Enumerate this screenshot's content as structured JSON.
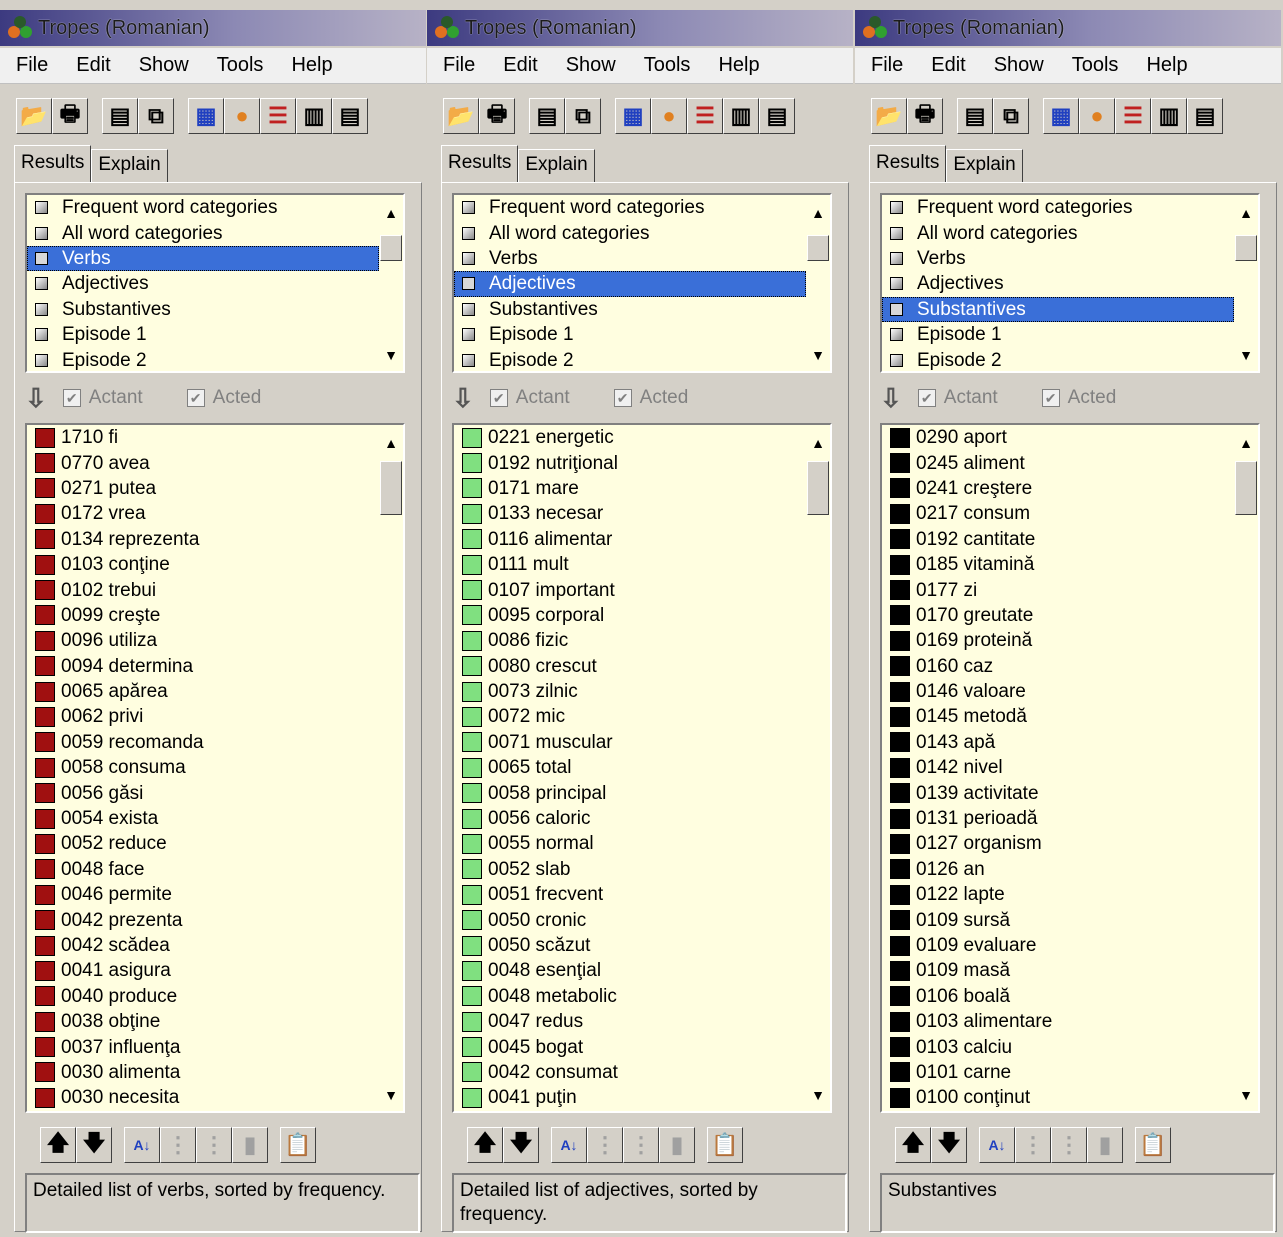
{
  "panels": [
    {
      "title": "Tropes (Romanian)",
      "menu": [
        "File",
        "Edit",
        "Show",
        "Tools",
        "Help"
      ],
      "tabs": [
        "Results",
        "Explain"
      ],
      "categories": [
        "Frequent word categories",
        "All word categories",
        "Verbs",
        "Adjectives",
        "Substantives",
        "Episode 1",
        "Episode 2"
      ],
      "selected_category": 2,
      "filters": {
        "actant": "Actant",
        "acted": "Acted"
      },
      "swatch_color": "#a01010",
      "words": [
        "1710 fi",
        "0770 avea",
        "0271 putea",
        "0172 vrea",
        "0134 reprezenta",
        "0103 conţine",
        "0102 trebui",
        "0099 creşte",
        "0096 utiliza",
        "0094 determina",
        "0065 apărea",
        "0062 privi",
        "0059 recomanda",
        "0058 consuma",
        "0056 găsi",
        "0054 exista",
        "0052 reduce",
        "0048 face",
        "0046 permite",
        "0042 prezenta",
        "0042 scădea",
        "0041 asigura",
        "0040 produce",
        "0038 obţine",
        "0037 influenţa",
        "0030 alimenta",
        "0030 necesita"
      ],
      "description": "Detailed list of verbs, sorted by frequency."
    },
    {
      "title": "Tropes (Romanian)",
      "menu": [
        "File",
        "Edit",
        "Show",
        "Tools",
        "Help"
      ],
      "tabs": [
        "Results",
        "Explain"
      ],
      "categories": [
        "Frequent word categories",
        "All word categories",
        "Verbs",
        "Adjectives",
        "Substantives",
        "Episode 1",
        "Episode 2"
      ],
      "selected_category": 3,
      "filters": {
        "actant": "Actant",
        "acted": "Acted"
      },
      "swatch_color": "#80e080",
      "words": [
        "0221 energetic",
        "0192 nutriţional",
        "0171 mare",
        "0133 necesar",
        "0116 alimentar",
        "0111 mult",
        "0107 important",
        "0095 corporal",
        "0086 fizic",
        "0080 crescut",
        "0073 zilnic",
        "0072 mic",
        "0071 muscular",
        "0065 total",
        "0058 principal",
        "0056 caloric",
        "0055 normal",
        "0052 slab",
        "0051 frecvent",
        "0050 cronic",
        "0050 scăzut",
        "0048 esenţial",
        "0048 metabolic",
        "0047 redus",
        "0045 bogat",
        "0042 consumat",
        "0041 puţin"
      ],
      "description": "Detailed list of adjectives, sorted by frequency."
    },
    {
      "title": "Tropes (Romanian)",
      "menu": [
        "File",
        "Edit",
        "Show",
        "Tools",
        "Help"
      ],
      "tabs": [
        "Results",
        "Explain"
      ],
      "categories": [
        "Frequent word categories",
        "All word categories",
        "Verbs",
        "Adjectives",
        "Substantives",
        "Episode 1",
        "Episode 2"
      ],
      "selected_category": 4,
      "filters": {
        "actant": "Actant",
        "acted": "Acted"
      },
      "swatch_color": "#000000",
      "words": [
        "0290 aport",
        "0245 aliment",
        "0241 creştere",
        "0217 consum",
        "0192 cantitate",
        "0185 vitamină",
        "0177 zi",
        "0170 greutate",
        "0169 proteină",
        "0160 caz",
        "0146 valoare",
        "0145 metodă",
        "0143 apă",
        "0142 nivel",
        "0139 activitate",
        "0131 perioadă",
        "0127 organism",
        "0126 an",
        "0122 lapte",
        "0109 sursă",
        "0109 evaluare",
        "0109 masă",
        "0106 boală",
        "0103 alimentare",
        "0103 calciu",
        "0101 carne",
        "0100 conţinut"
      ],
      "description": "Substantives"
    }
  ]
}
